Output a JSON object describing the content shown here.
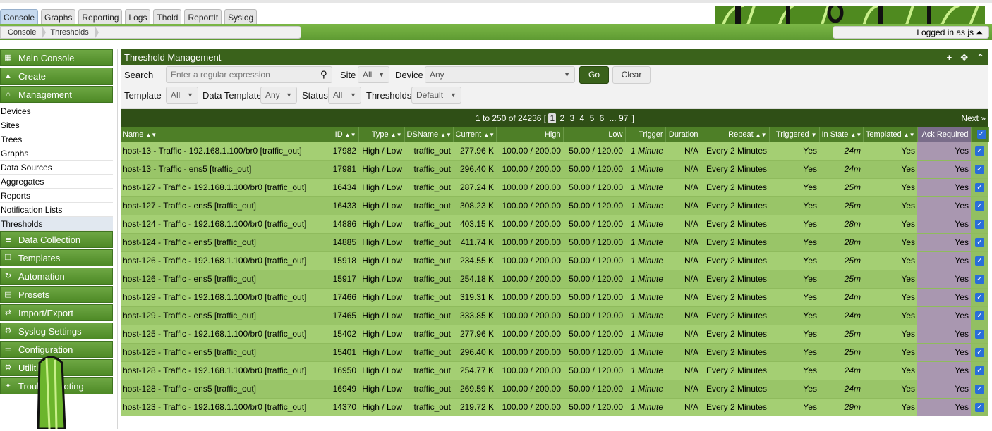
{
  "tabs": [
    "Console",
    "Graphs",
    "Reporting",
    "Logs",
    "Thold",
    "ReportIt",
    "Syslog"
  ],
  "breadcrumb": [
    "Console",
    "Thresholds"
  ],
  "user": {
    "label": "Logged in as js ⏶"
  },
  "sidebar": {
    "top": [
      {
        "label": "Main Console",
        "icon": "map-icon"
      },
      {
        "label": "Create",
        "icon": "chart-icon"
      },
      {
        "label": "Management",
        "icon": "home-icon"
      }
    ],
    "items": [
      "Devices",
      "Sites",
      "Trees",
      "Graphs",
      "Data Sources",
      "Aggregates",
      "Reports",
      "Notification Lists",
      "Thresholds"
    ],
    "selected": "Thresholds",
    "bottom": [
      {
        "label": "Data Collection",
        "icon": "database-icon"
      },
      {
        "label": "Templates",
        "icon": "copy-icon"
      },
      {
        "label": "Automation",
        "icon": "automation-icon"
      },
      {
        "label": "Presets",
        "icon": "archive-icon"
      },
      {
        "label": "Import/Export",
        "icon": "exchange-icon"
      },
      {
        "label": "Syslog Settings",
        "icon": "settings-icon"
      },
      {
        "label": "Configuration",
        "icon": "sliders-icon"
      },
      {
        "label": "Utilities",
        "icon": "cogs-icon"
      },
      {
        "label": "Troubleshooting",
        "icon": "bug-icon"
      }
    ]
  },
  "panel": {
    "title": "Threshold Management",
    "filters": {
      "search_label": "Search",
      "search_placeholder": "Enter a regular expression",
      "site_label": "Site",
      "site_value": "All",
      "device_label": "Device",
      "device_value": "Any",
      "go": "Go",
      "clear": "Clear",
      "template_label": "Template",
      "template_value": "All",
      "data_template_label": "Data Template",
      "data_template_value": "Any",
      "status_label": "Status",
      "status_value": "All",
      "thresholds_label": "Thresholds",
      "thresholds_value": "Default"
    },
    "pager": {
      "text": "1 to 250 of 24236 [",
      "pages": [
        "1",
        "2",
        "3",
        "4",
        "5",
        "6",
        "... 97"
      ],
      "current": "1",
      "end": "]",
      "next": "Next »"
    },
    "columns": [
      "Name",
      "ID",
      "Type",
      "DSName",
      "Current",
      "High",
      "Low",
      "Trigger",
      "Duration",
      "Repeat",
      "Triggered",
      "In State",
      "Templated",
      "Ack Required"
    ],
    "rows": [
      [
        "host-13 - Traffic - 192.168.1.100/br0 [traffic_out]",
        "17982",
        "High / Low",
        "traffic_out",
        "277.96 K",
        "100.00 / 200.00",
        "50.00 / 120.00",
        "1 Minute",
        "N/A",
        "Every 2 Minutes",
        "Yes",
        "24m",
        "Yes",
        "Yes"
      ],
      [
        "host-13 - Traffic - ens5 [traffic_out]",
        "17981",
        "High / Low",
        "traffic_out",
        "296.40 K",
        "100.00 / 200.00",
        "50.00 / 120.00",
        "1 Minute",
        "N/A",
        "Every 2 Minutes",
        "Yes",
        "24m",
        "Yes",
        "Yes"
      ],
      [
        "host-127 - Traffic - 192.168.1.100/br0 [traffic_out]",
        "16434",
        "High / Low",
        "traffic_out",
        "287.24 K",
        "100.00 / 200.00",
        "50.00 / 120.00",
        "1 Minute",
        "N/A",
        "Every 2 Minutes",
        "Yes",
        "25m",
        "Yes",
        "Yes"
      ],
      [
        "host-127 - Traffic - ens5 [traffic_out]",
        "16433",
        "High / Low",
        "traffic_out",
        "308.23 K",
        "100.00 / 200.00",
        "50.00 / 120.00",
        "1 Minute",
        "N/A",
        "Every 2 Minutes",
        "Yes",
        "25m",
        "Yes",
        "Yes"
      ],
      [
        "host-124 - Traffic - 192.168.1.100/br0 [traffic_out]",
        "14886",
        "High / Low",
        "traffic_out",
        "403.15 K",
        "100.00 / 200.00",
        "50.00 / 120.00",
        "1 Minute",
        "N/A",
        "Every 2 Minutes",
        "Yes",
        "28m",
        "Yes",
        "Yes"
      ],
      [
        "host-124 - Traffic - ens5 [traffic_out]",
        "14885",
        "High / Low",
        "traffic_out",
        "411.74 K",
        "100.00 / 200.00",
        "50.00 / 120.00",
        "1 Minute",
        "N/A",
        "Every 2 Minutes",
        "Yes",
        "28m",
        "Yes",
        "Yes"
      ],
      [
        "host-126 - Traffic - 192.168.1.100/br0 [traffic_out]",
        "15918",
        "High / Low",
        "traffic_out",
        "234.55 K",
        "100.00 / 200.00",
        "50.00 / 120.00",
        "1 Minute",
        "N/A",
        "Every 2 Minutes",
        "Yes",
        "25m",
        "Yes",
        "Yes"
      ],
      [
        "host-126 - Traffic - ens5 [traffic_out]",
        "15917",
        "High / Low",
        "traffic_out",
        "254.18 K",
        "100.00 / 200.00",
        "50.00 / 120.00",
        "1 Minute",
        "N/A",
        "Every 2 Minutes",
        "Yes",
        "25m",
        "Yes",
        "Yes"
      ],
      [
        "host-129 - Traffic - 192.168.1.100/br0 [traffic_out]",
        "17466",
        "High / Low",
        "traffic_out",
        "319.31 K",
        "100.00 / 200.00",
        "50.00 / 120.00",
        "1 Minute",
        "N/A",
        "Every 2 Minutes",
        "Yes",
        "24m",
        "Yes",
        "Yes"
      ],
      [
        "host-129 - Traffic - ens5 [traffic_out]",
        "17465",
        "High / Low",
        "traffic_out",
        "333.85 K",
        "100.00 / 200.00",
        "50.00 / 120.00",
        "1 Minute",
        "N/A",
        "Every 2 Minutes",
        "Yes",
        "24m",
        "Yes",
        "Yes"
      ],
      [
        "host-125 - Traffic - 192.168.1.100/br0 [traffic_out]",
        "15402",
        "High / Low",
        "traffic_out",
        "277.96 K",
        "100.00 / 200.00",
        "50.00 / 120.00",
        "1 Minute",
        "N/A",
        "Every 2 Minutes",
        "Yes",
        "25m",
        "Yes",
        "Yes"
      ],
      [
        "host-125 - Traffic - ens5 [traffic_out]",
        "15401",
        "High / Low",
        "traffic_out",
        "296.40 K",
        "100.00 / 200.00",
        "50.00 / 120.00",
        "1 Minute",
        "N/A",
        "Every 2 Minutes",
        "Yes",
        "25m",
        "Yes",
        "Yes"
      ],
      [
        "host-128 - Traffic - 192.168.1.100/br0 [traffic_out]",
        "16950",
        "High / Low",
        "traffic_out",
        "254.77 K",
        "100.00 / 200.00",
        "50.00 / 120.00",
        "1 Minute",
        "N/A",
        "Every 2 Minutes",
        "Yes",
        "24m",
        "Yes",
        "Yes"
      ],
      [
        "host-128 - Traffic - ens5 [traffic_out]",
        "16949",
        "High / Low",
        "traffic_out",
        "269.59 K",
        "100.00 / 200.00",
        "50.00 / 120.00",
        "1 Minute",
        "N/A",
        "Every 2 Minutes",
        "Yes",
        "24m",
        "Yes",
        "Yes"
      ],
      [
        "host-123 - Traffic - 192.168.1.100/br0 [traffic_out]",
        "14370",
        "High / Low",
        "traffic_out",
        "219.72 K",
        "100.00 / 200.00",
        "50.00 / 120.00",
        "1 Minute",
        "N/A",
        "Every 2 Minutes",
        "Yes",
        "29m",
        "Yes",
        "Yes"
      ]
    ]
  },
  "colors": {
    "header": "#3a621b",
    "nav": "#2f4f16",
    "row": "#a4cf73",
    "row_alt": "#99c568",
    "ack": "#a997b0",
    "accent": "#2a6ed8"
  }
}
